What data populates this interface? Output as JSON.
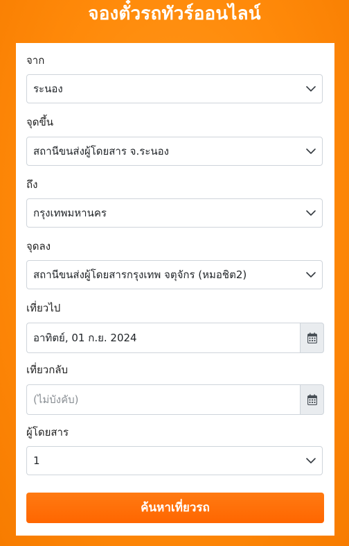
{
  "header": {
    "title": "จองตั๋วรถทัวร์ออนไลน์"
  },
  "form": {
    "from": {
      "label": "จาก",
      "value": "ระนอง",
      "icon": "chevron-down-icon"
    },
    "pickup": {
      "label": "จุดขึ้น",
      "value": "สถานีขนส่งผู้โดยสาร จ.ระนอง",
      "icon": "chevron-down-icon"
    },
    "to": {
      "label": "ถึง",
      "value": "กรุงเทพมหานคร",
      "icon": "chevron-down-icon"
    },
    "dropoff": {
      "label": "จุดลง",
      "value": "สถานีขนส่งผู้โดยสารกรุงเทพ จตุจักร (หมอชิต2)",
      "icon": "chevron-down-icon"
    },
    "depart": {
      "label": "เที่ยวไป",
      "value": "อาทิตย์, 01 ก.ย. 2024",
      "icon": "calendar-icon"
    },
    "return": {
      "label": "เที่ยวกลับ",
      "value": "",
      "placeholder": "(ไม่บังคับ)",
      "icon": "calendar-icon"
    },
    "passengers": {
      "label": "ผู้โดยสาร",
      "value": "1",
      "icon": "chevron-down-icon"
    },
    "submit_label": "ค้นหาเที่ยวรถ"
  },
  "colors": {
    "background": "#ff8a0a",
    "button": "#ff6a00",
    "border": "#ced4da",
    "addon": "#e9ecef"
  }
}
